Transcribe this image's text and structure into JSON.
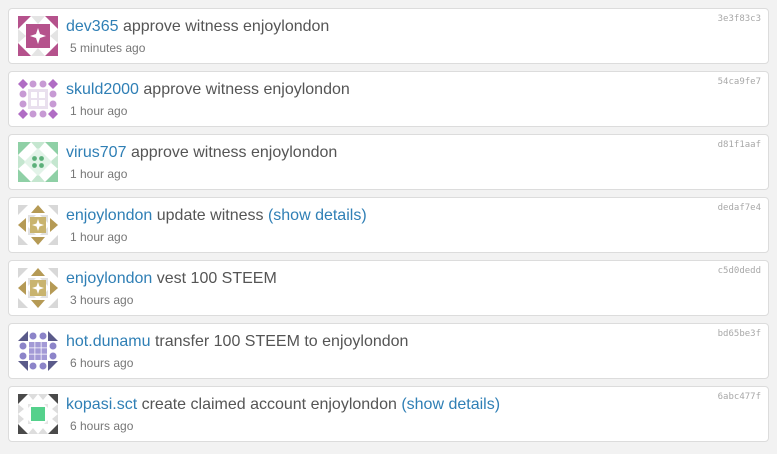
{
  "feed": {
    "items": [
      {
        "user": "dev365",
        "action": "approve witness enjoylondon",
        "details_label": "",
        "time": "5 minutes ago",
        "hash": "3e3f83c3",
        "avatar": {
          "name": "dev365-avatar",
          "color": "#b5528c"
        }
      },
      {
        "user": "skuld2000",
        "action": "approve witness enjoylondon",
        "details_label": "",
        "time": "1 hour ago",
        "hash": "54ca9fe7",
        "avatar": {
          "name": "skuld2000-avatar",
          "color": "#b06cc4"
        }
      },
      {
        "user": "virus707",
        "action": "approve witness enjoylondon",
        "details_label": "",
        "time": "1 hour ago",
        "hash": "d81f1aaf",
        "avatar": {
          "name": "virus707-avatar",
          "color": "#5cb07a"
        }
      },
      {
        "user": "enjoylondon",
        "action": "update witness",
        "details_label": "(show details)",
        "time": "1 hour ago",
        "hash": "dedaf7e4",
        "avatar": {
          "name": "enjoylondon-avatar",
          "color": "#b59a55"
        }
      },
      {
        "user": "enjoylondon",
        "action": "vest 100 STEEM",
        "details_label": "",
        "time": "3 hours ago",
        "hash": "c5d0dedd",
        "avatar": {
          "name": "enjoylondon-avatar",
          "color": "#b59a55"
        }
      },
      {
        "user": "hot.dunamu",
        "action": "transfer 100 STEEM to enjoylondon",
        "details_label": "",
        "time": "6 hours ago",
        "hash": "bd65be3f",
        "avatar": {
          "name": "hot-dunamu-avatar",
          "color": "#8c84c9"
        }
      },
      {
        "user": "kopasi.sct",
        "action": "create claimed account enjoylondon",
        "details_label": "(show details)",
        "time": "6 hours ago",
        "hash": "6abc477f",
        "avatar": {
          "name": "kopasi-sct-avatar",
          "color": "#55d18c"
        }
      }
    ]
  },
  "colors": {
    "link": "#2f7fb5",
    "text": "#555555",
    "muted": "#777777",
    "hash": "#a8a8a8",
    "card_border": "#dcdcdc",
    "page_background": "#f2f2f2"
  }
}
